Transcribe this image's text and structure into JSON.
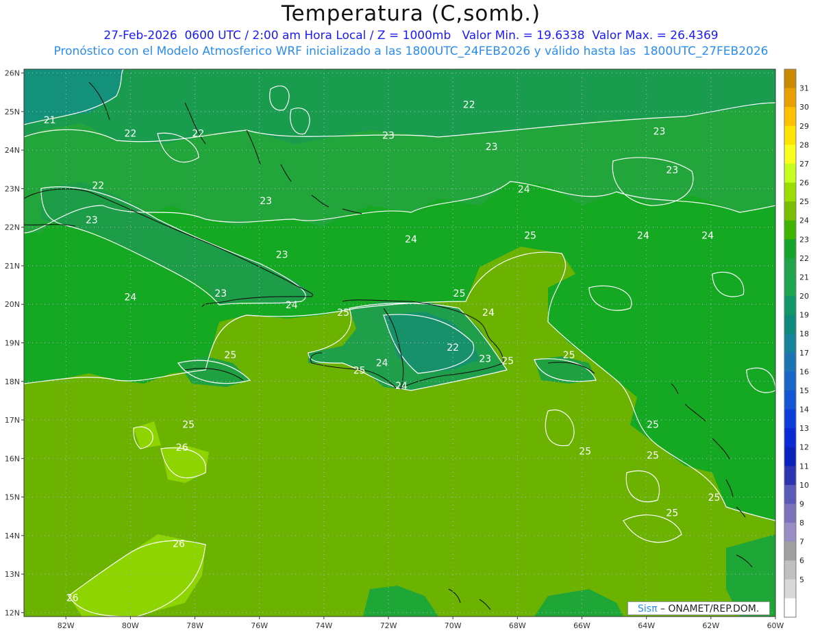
{
  "header": {
    "title": "Temperatura (C,somb.)",
    "line1": "27-Feb-2026  0600 UTC / 2:00 am Hora Local / Z = 1000mb   Valor Min. = 19.6338  Valor Max. = 26.4369",
    "line2": "Pronóstico con el Modelo Atmosferico WRF inicializado a las 1800UTC_24FEB2026 y válido hasta las  1800UTC_27FEB2026"
  },
  "map": {
    "lat_labels": [
      "26N",
      "25N",
      "24N",
      "23N",
      "22N",
      "21N",
      "20N",
      "19N",
      "18N",
      "17N",
      "16N",
      "15N",
      "14N",
      "13N",
      "12N"
    ],
    "lon_labels": [
      "82W",
      "80W",
      "78W",
      "76W",
      "74W",
      "72W",
      "70W",
      "68W",
      "66W",
      "64W",
      "62W",
      "60W"
    ],
    "contour_labels": [
      {
        "text": "21",
        "lon": -82.5,
        "lat": 24.7
      },
      {
        "text": "22",
        "lon": -80.0,
        "lat": 24.35
      },
      {
        "text": "22",
        "lon": -77.9,
        "lat": 24.35
      },
      {
        "text": "22",
        "lon": -81.0,
        "lat": 23.0
      },
      {
        "text": "23",
        "lon": -81.2,
        "lat": 22.1
      },
      {
        "text": "23",
        "lon": -75.8,
        "lat": 22.6
      },
      {
        "text": "23",
        "lon": -75.3,
        "lat": 21.2
      },
      {
        "text": "23",
        "lon": -77.2,
        "lat": 20.2
      },
      {
        "text": "24",
        "lon": -75.0,
        "lat": 19.9
      },
      {
        "text": "24",
        "lon": -80.0,
        "lat": 20.1
      },
      {
        "text": "22",
        "lon": -69.5,
        "lat": 25.1
      },
      {
        "text": "23",
        "lon": -72.0,
        "lat": 24.3
      },
      {
        "text": "23",
        "lon": -68.8,
        "lat": 24.0
      },
      {
        "text": "23",
        "lon": -63.6,
        "lat": 24.4
      },
      {
        "text": "23",
        "lon": -63.2,
        "lat": 23.4
      },
      {
        "text": "24",
        "lon": -67.8,
        "lat": 22.9
      },
      {
        "text": "24",
        "lon": -71.3,
        "lat": 21.6
      },
      {
        "text": "25",
        "lon": -67.6,
        "lat": 21.7
      },
      {
        "text": "24",
        "lon": -64.1,
        "lat": 21.7
      },
      {
        "text": "24",
        "lon": -62.1,
        "lat": 21.7
      },
      {
        "text": "25",
        "lon": -69.8,
        "lat": 20.2
      },
      {
        "text": "25",
        "lon": -73.4,
        "lat": 19.7
      },
      {
        "text": "24",
        "lon": -68.9,
        "lat": 19.7
      },
      {
        "text": "22",
        "lon": -70.0,
        "lat": 18.8
      },
      {
        "text": "23",
        "lon": -69.0,
        "lat": 18.5
      },
      {
        "text": "25",
        "lon": -68.3,
        "lat": 18.45
      },
      {
        "text": "24",
        "lon": -72.2,
        "lat": 18.4
      },
      {
        "text": "25",
        "lon": -72.9,
        "lat": 18.2
      },
      {
        "text": "24",
        "lon": -71.6,
        "lat": 17.8
      },
      {
        "text": "25",
        "lon": -76.9,
        "lat": 18.6
      },
      {
        "text": "25",
        "lon": -66.4,
        "lat": 18.6
      },
      {
        "text": "25",
        "lon": -78.2,
        "lat": 16.8
      },
      {
        "text": "26",
        "lon": -78.4,
        "lat": 16.2
      },
      {
        "text": "25",
        "lon": -65.9,
        "lat": 16.1
      },
      {
        "text": "25",
        "lon": -63.8,
        "lat": 16.8
      },
      {
        "text": "25",
        "lon": -63.8,
        "lat": 16.0
      },
      {
        "text": "25",
        "lon": -61.9,
        "lat": 14.9
      },
      {
        "text": "25",
        "lon": -63.2,
        "lat": 14.5
      },
      {
        "text": "26",
        "lon": -78.5,
        "lat": 13.7
      },
      {
        "text": "26",
        "lon": -81.8,
        "lat": 12.3
      }
    ]
  },
  "colorbar": {
    "labels": [
      "31",
      "30",
      "29",
      "28",
      "27",
      "26",
      "25",
      "24",
      "23",
      "22",
      "21",
      "20",
      "19",
      "18",
      "17",
      "16",
      "15",
      "14",
      "13",
      "12",
      "11",
      "10",
      "9",
      "8",
      "7",
      "6",
      "5"
    ],
    "colors": [
      "#c98a00",
      "#e8a000",
      "#ffc000",
      "#ffe400",
      "#fbff1e",
      "#c6ff1e",
      "#9cdd00",
      "#7bbd00",
      "#3fb300",
      "#16a52c",
      "#20a34a",
      "#1ea54f",
      "#11966a",
      "#0d8a7a",
      "#17839a",
      "#1c74b3",
      "#1a66c8",
      "#1456d6",
      "#0e3ed9",
      "#0a2ad5",
      "#0a22bd",
      "#2e34b0",
      "#5a5ab8",
      "#7b74b8",
      "#9a8ec4",
      "#a0a0a0",
      "#c0c0c0",
      "#d9d9d9",
      "#ffffff"
    ]
  },
  "credit": {
    "brand": "Sisπ",
    "text": "– ONAMET/REP.DOM."
  }
}
